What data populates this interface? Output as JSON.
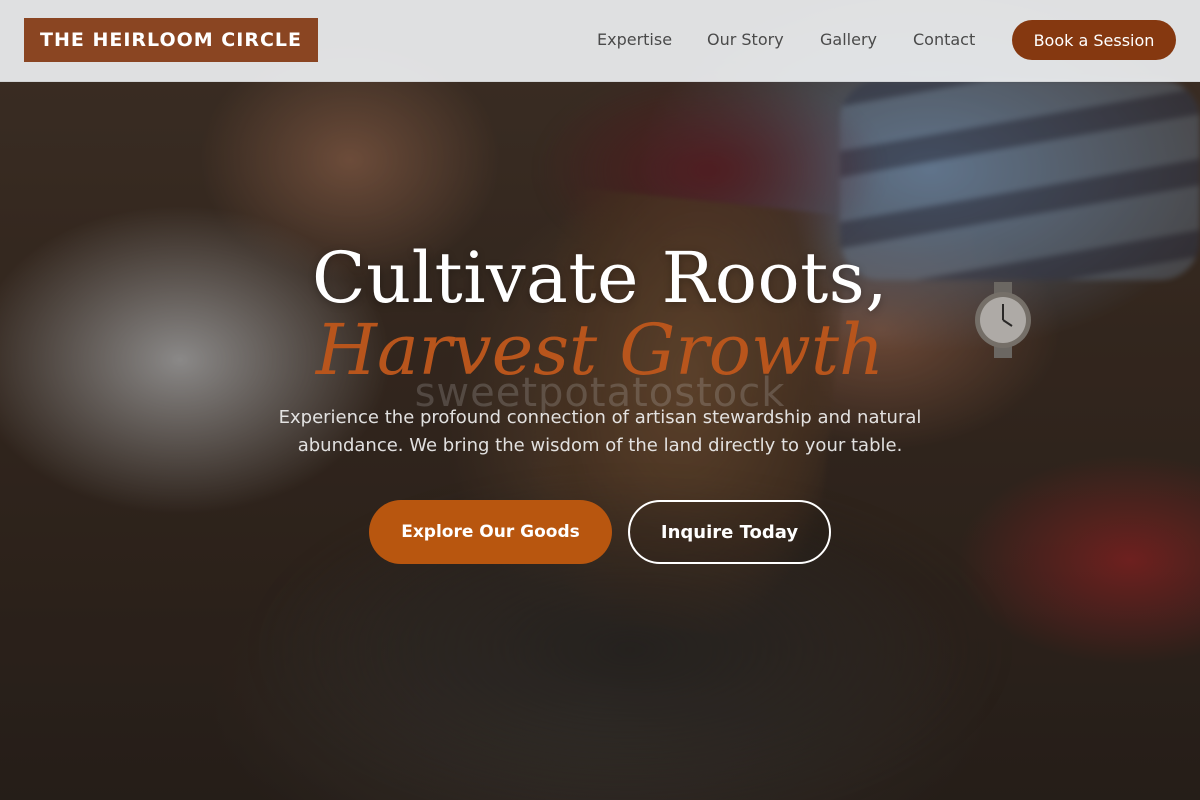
{
  "header": {
    "logo": "THE HEIRLOOM CIRCLE",
    "nav": {
      "expertise": "Expertise",
      "story": "Our Story",
      "gallery": "Gallery",
      "contact": "Contact"
    },
    "cta": "Book a Session"
  },
  "hero": {
    "headline_line1": "Cultivate Roots,",
    "headline_line2": "Harvest Growth",
    "watermark": "sweetpotatostock",
    "description": "Experience the profound connection of artisan stewardship and natural abundance. We bring the wisdom of the land directly to your table.",
    "primary_button": "Explore Our Goods",
    "secondary_button": "Inquire Today",
    "background_image": "artisan-hands-working-wood-photo"
  },
  "colors": {
    "brand": "#8a4522",
    "accent": "#b8551c",
    "cta_dark": "#853810"
  }
}
